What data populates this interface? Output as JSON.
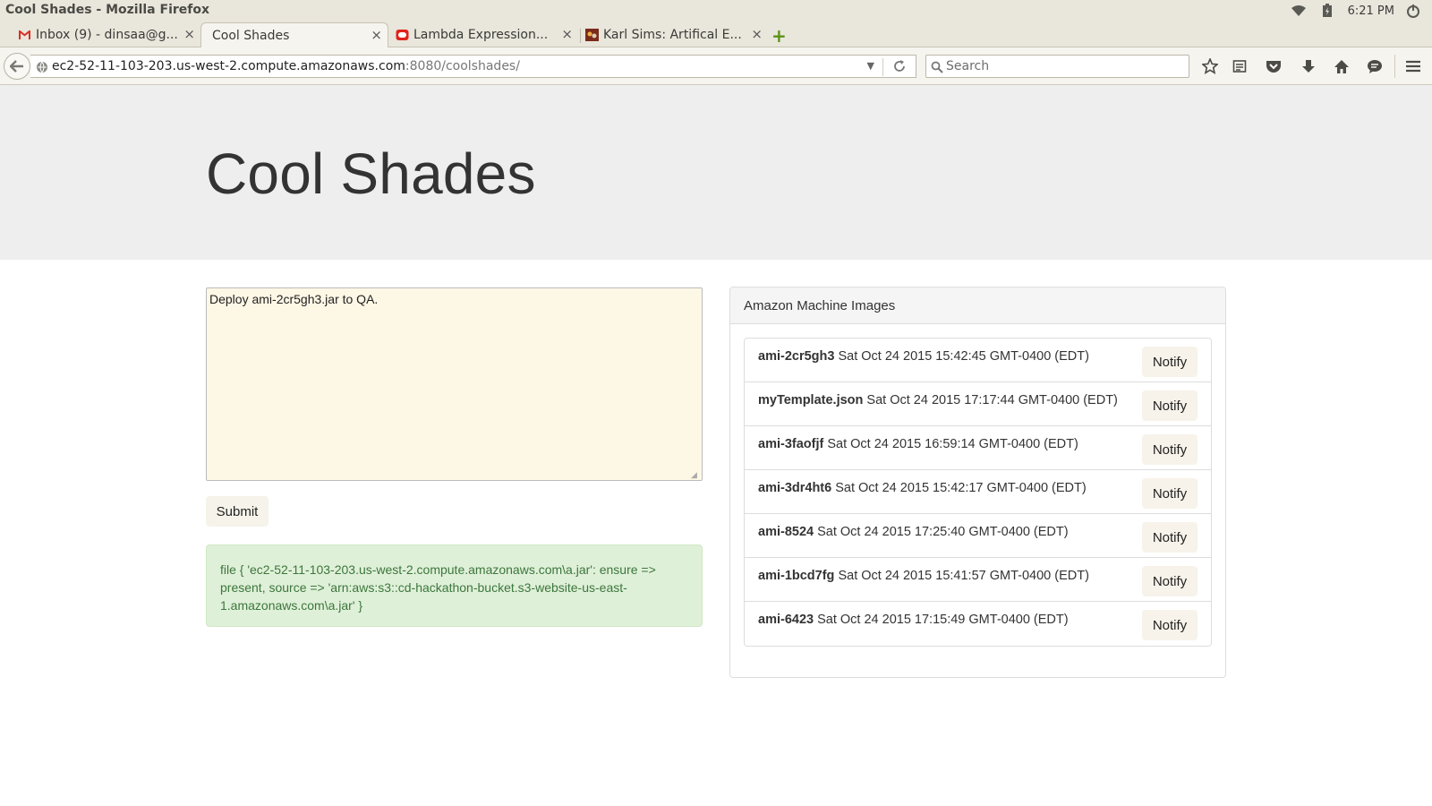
{
  "window": {
    "title": "Cool Shades - Mozilla Firefox"
  },
  "system_tray": {
    "clock": "6:21 PM",
    "icons": [
      "wifi-icon",
      "battery-icon",
      "power-icon"
    ]
  },
  "tabs": [
    {
      "label": "Inbox (9) - dinsaa@g...",
      "icon": "gmail-icon",
      "active": false
    },
    {
      "label": "Cool Shades",
      "icon": "",
      "active": true
    },
    {
      "label": "Lambda Expression...",
      "icon": "oracle-icon",
      "active": false
    },
    {
      "label": "Karl Sims: Artifical E...",
      "icon": "karl-sims-icon",
      "active": false
    }
  ],
  "tab_close_glyph": "×",
  "new_tab_glyph": "+",
  "navbar": {
    "url_host": "ec2-52-11-103-203.us-west-2.compute.amazonaws.com",
    "url_rest": ":8080/coolshades/",
    "search_placeholder": "Search",
    "toolbar_icons": [
      "bookmark-star-icon",
      "reading-list-icon",
      "pocket-icon",
      "download-icon",
      "home-icon",
      "chat-icon",
      "menu-icon"
    ]
  },
  "page": {
    "heading": "Cool Shades",
    "message": "Deploy ami-2cr5gh3.jar to QA.",
    "submit_label": "Submit",
    "result_text": "file { 'ec2-52-11-103-203.us-west-2.compute.amazonaws.com\\a.jar': ensure => present, source => 'arn:aws:s3::cd-hackathon-bucket.s3-website-us-east-1.amazonaws.com\\a.jar' }",
    "panel_title": "Amazon Machine Images",
    "images": [
      {
        "name": "ami-2cr5gh3",
        "date": "Sat Oct 24 2015 15:42:45 GMT-0400 (EDT)",
        "action": "Notify"
      },
      {
        "name": "myTemplate.json",
        "date": "Sat Oct 24 2015 17:17:44 GMT-0400 (EDT)",
        "action": "Notify"
      },
      {
        "name": "ami-3faofjf",
        "date": "Sat Oct 24 2015 16:59:14 GMT-0400 (EDT)",
        "action": "Notify"
      },
      {
        "name": "ami-3dr4ht6",
        "date": "Sat Oct 24 2015 15:42:17 GMT-0400 (EDT)",
        "action": "Notify"
      },
      {
        "name": "ami-8524",
        "date": "Sat Oct 24 2015 17:25:40 GMT-0400 (EDT)",
        "action": "Notify"
      },
      {
        "name": "ami-1bcd7fg",
        "date": "Sat Oct 24 2015 15:41:57 GMT-0400 (EDT)",
        "action": "Notify"
      },
      {
        "name": "ami-6423",
        "date": "Sat Oct 24 2015 17:15:49 GMT-0400 (EDT)",
        "action": "Notify"
      }
    ]
  },
  "colors": {
    "jumbotron_bg": "#eeeeee",
    "textarea_bg": "#fdf7e5",
    "success_bg": "#dff0d8",
    "success_text": "#3c763d",
    "button_bg": "#f7f3ea",
    "chrome_bg": "#e9e6dc"
  }
}
